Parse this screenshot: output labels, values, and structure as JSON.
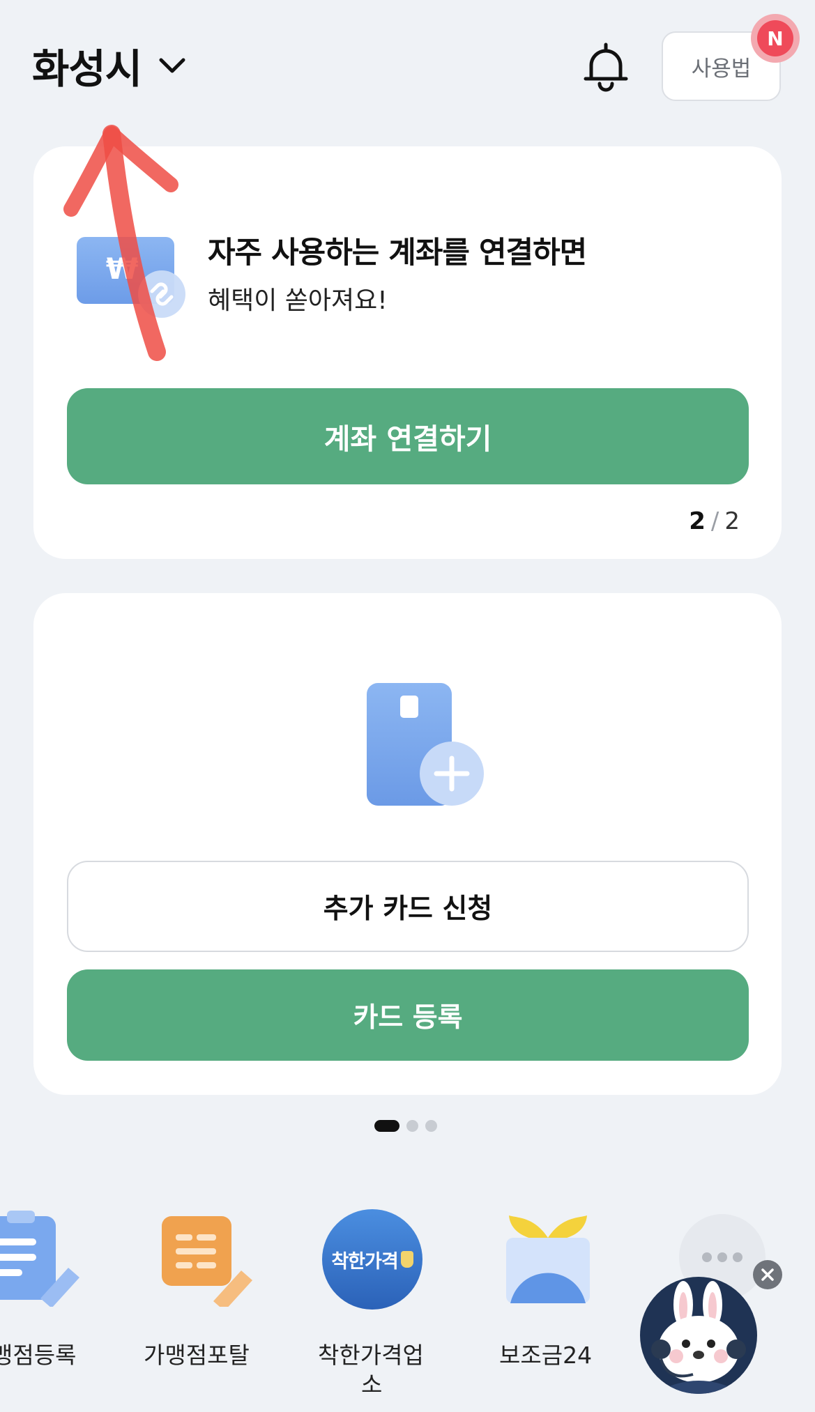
{
  "header": {
    "region": "화성시",
    "help_label": "사용법",
    "badge": "N"
  },
  "promo_card": {
    "title": "자주 사용하는 계좌를 연결하면",
    "subtitle": "혜택이 쏟아져요!",
    "button": "계좌 연결하기",
    "page_current": "2",
    "page_separator": "/",
    "page_total": "2"
  },
  "card_section": {
    "apply_button": "추가 카드 신청",
    "register_button": "카드 등록"
  },
  "carousel": {
    "total": 3,
    "active": 1
  },
  "quick_menu": {
    "items": [
      {
        "label": "맹점등록",
        "icon": "clipboard-pencil-icon"
      },
      {
        "label": "가맹점포탈",
        "icon": "document-pencil-icon"
      },
      {
        "label": "착한가격업",
        "label2": "소",
        "icon": "good-price-badge-icon",
        "icon_text": "착한가격"
      },
      {
        "label": "보조금24",
        "icon": "gift-box-icon"
      },
      {
        "label": "",
        "icon": "more-icon"
      }
    ]
  },
  "colors": {
    "background": "#eff2f6",
    "primary_green": "#56ab80",
    "badge_red": "#ef4a5a",
    "annotation_arrow": "#ef4d45"
  }
}
